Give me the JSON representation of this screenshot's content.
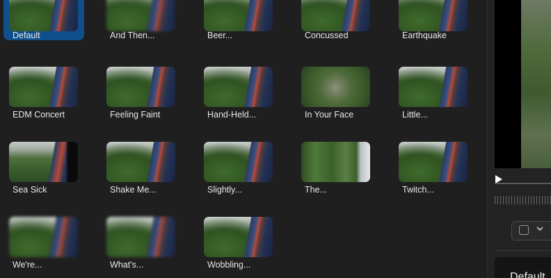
{
  "effects": [
    {
      "label": "Default",
      "selected": true,
      "style": "normal"
    },
    {
      "label": "And Then...",
      "selected": false,
      "style": "blur"
    },
    {
      "label": "Beer...",
      "selected": false,
      "style": "normal"
    },
    {
      "label": "Concussed",
      "selected": false,
      "style": "normal"
    },
    {
      "label": "Earthquake",
      "selected": false,
      "style": "normal"
    },
    {
      "label": "EDM Concert",
      "selected": false,
      "style": "normal"
    },
    {
      "label": "Feeling Faint",
      "selected": false,
      "style": "normal"
    },
    {
      "label": "Hand-Held...",
      "selected": false,
      "style": "normal"
    },
    {
      "label": "In Your Face",
      "selected": false,
      "style": "zoom"
    },
    {
      "label": "Little...",
      "selected": false,
      "style": "normal"
    },
    {
      "label": "Sea Sick",
      "selected": false,
      "style": "dark-edge"
    },
    {
      "label": "Shake Me...",
      "selected": false,
      "style": "normal"
    },
    {
      "label": "Slightly...",
      "selected": false,
      "style": "normal"
    },
    {
      "label": "The...",
      "selected": false,
      "style": "tilt"
    },
    {
      "label": "Twitch...",
      "selected": false,
      "style": "normal"
    },
    {
      "label": "We're...",
      "selected": false,
      "style": "blur"
    },
    {
      "label": "What's...",
      "selected": false,
      "style": "blur"
    },
    {
      "label": "Wobbling...",
      "selected": false,
      "style": "normal"
    }
  ],
  "side_panel": {
    "bottom_label": "Default",
    "dropdown_icon": "chevron-down-icon",
    "play_icon": "play-icon"
  },
  "colors": {
    "selected": "#0e4f8c",
    "background": "#1f1f1f"
  }
}
